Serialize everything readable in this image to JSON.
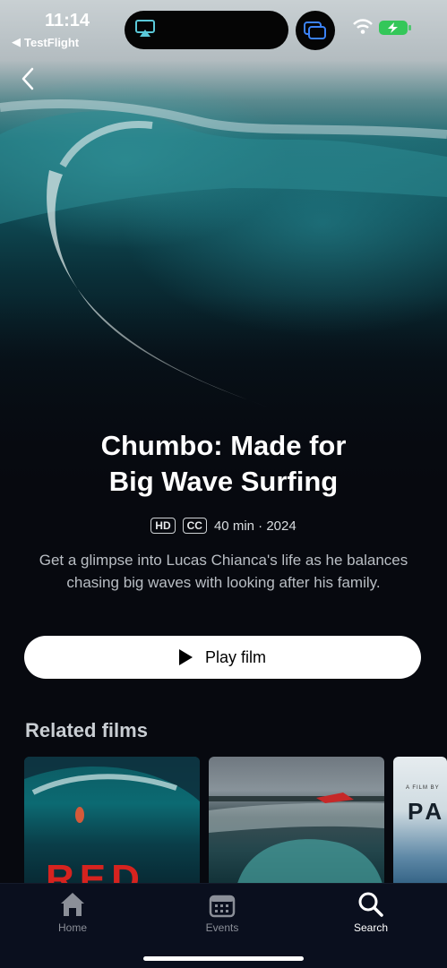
{
  "status_bar": {
    "time": "11:14",
    "back_app": "TestFlight"
  },
  "film": {
    "title": "Chumbo: Made for\nBig Wave Surfing",
    "badges": [
      "HD",
      "CC"
    ],
    "meta": "40 min · 2024",
    "description": "Get a glimpse into Lucas Chianca's life as he balances chasing big waves with looking after his family.",
    "play_label": "Play film"
  },
  "related": {
    "heading": "Related films",
    "cards": [
      {
        "text": "RED"
      },
      {
        "text": ""
      },
      {
        "small": "A FILM BY",
        "text": "PA"
      }
    ]
  },
  "tabbar": {
    "items": [
      {
        "label": "Home",
        "icon": "home-icon"
      },
      {
        "label": "Events",
        "icon": "calendar-icon"
      },
      {
        "label": "Search",
        "icon": "search-icon",
        "active": true
      }
    ]
  },
  "colors": {
    "background": "#07090f",
    "tabbar": "#0a0f1e",
    "accent_red": "#d6231f",
    "battery": "#34c759"
  }
}
